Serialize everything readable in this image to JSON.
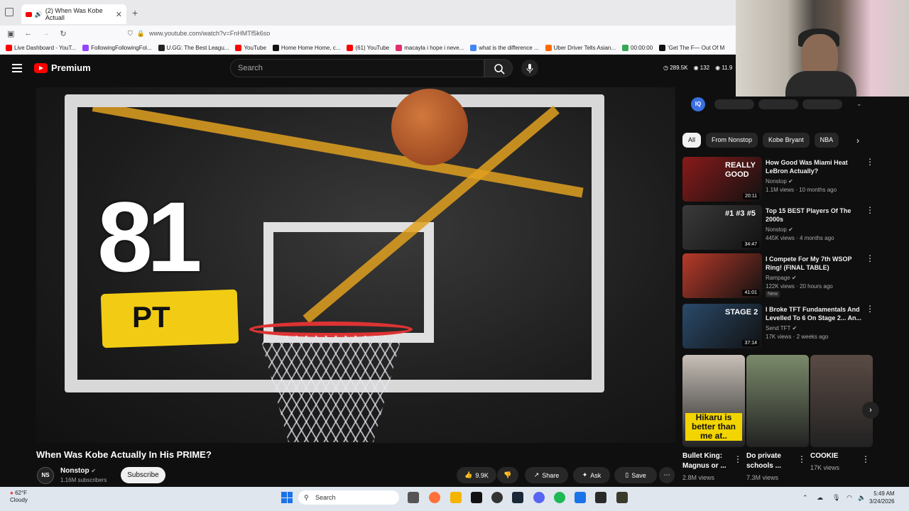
{
  "browser": {
    "tab_title": "(2) When Was Kobe Actuall",
    "url": "www.youtube.com/watch?v=FnHMTf5k6so",
    "bookmarks": [
      {
        "label": "Live Dashboard - YouT...",
        "color": "#ff0000"
      },
      {
        "label": "FollowingFollowingFol...",
        "color": "#9146ff"
      },
      {
        "label": "U.GG: The Best Leagu...",
        "color": "#222222"
      },
      {
        "label": "YouTube",
        "color": "#ff0000"
      },
      {
        "label": "Home Home Home, c...",
        "color": "#111111"
      },
      {
        "label": "(61) YouTube",
        "color": "#ff0000"
      },
      {
        "label": "macayla i hope i neve...",
        "color": "#e1306c"
      },
      {
        "label": "what is the difference ...",
        "color": "#4285f4"
      },
      {
        "label": "Uber Driver Tells Asian...",
        "color": "#ff6a00"
      },
      {
        "label": "00:00:00",
        "color": "#34a853"
      },
      {
        "label": "'Get The F— Out Of M",
        "color": "#111111"
      }
    ]
  },
  "header": {
    "logo_text": "Premium",
    "search_placeholder": "Search",
    "stats": [
      "289.5K",
      "132",
      "11.9"
    ]
  },
  "video": {
    "overlay_number": "81",
    "overlay_label": "PT",
    "title": "When Was Kobe Actually In His PRIME?",
    "channel": "Nonstop",
    "channel_logo": "NS",
    "subscribers": "1.16M subscribers",
    "subscribe_label": "Subscribe",
    "likes": "9.9K",
    "share_label": "Share",
    "ask_label": "Ask",
    "save_label": "Save"
  },
  "sidebar": {
    "iq_logo": "IQ",
    "chips": [
      "All",
      "From Nonstop",
      "Kobe Bryant",
      "NBA"
    ],
    "recommendations": [
      {
        "title": "How Good Was Miami Heat LeBron Actually?",
        "channel": "Nonstop",
        "meta": "1.1M views · 10 months ago",
        "duration": "20:11",
        "badge": "",
        "thumb_text": "REALLY GOOD",
        "thumb_color": "#8a1a1a"
      },
      {
        "title": "Top 15 BEST Players Of The 2000s",
        "channel": "Nonstop",
        "meta": "445K views · 4 months ago",
        "duration": "34:47",
        "badge": "",
        "thumb_text": "#1 #3 #5",
        "thumb_color": "#3a3a3a"
      },
      {
        "title": "I Compete For My 7th WSOP Ring! (FINAL TABLE)",
        "channel": "Rampage",
        "meta": "122K views · 20 hours ago",
        "duration": "41:01",
        "badge": "New",
        "thumb_text": "",
        "thumb_color": "#b83a2a"
      },
      {
        "title": "I Broke TFT Fundamentals And Levelled To 6 On Stage 2... An...",
        "channel": "Send TFT",
        "meta": "17K views · 2 weeks ago",
        "duration": "37:14",
        "badge": "",
        "thumb_text": "STAGE 2",
        "thumb_color": "#2a4a6a"
      }
    ],
    "shorts": [
      {
        "title": "Bullet King: Magnus or ...",
        "views": "2.8M views",
        "thumb_text": "Hikaru is better than me at..",
        "thumb_color": "#c8c0b8"
      },
      {
        "title": "Do private schools ...",
        "views": "7.3M views",
        "thumb_text": "",
        "thumb_color": "#7a8a6a"
      },
      {
        "title": "COOKIE",
        "views": "17K views",
        "thumb_text": "",
        "thumb_color": "#5a4a44"
      }
    ]
  },
  "taskbar": {
    "weather_temp": "62°F",
    "weather_desc": "Cloudy",
    "search_label": "Search",
    "time": "5:49 AM",
    "date": "3/24/2026"
  }
}
